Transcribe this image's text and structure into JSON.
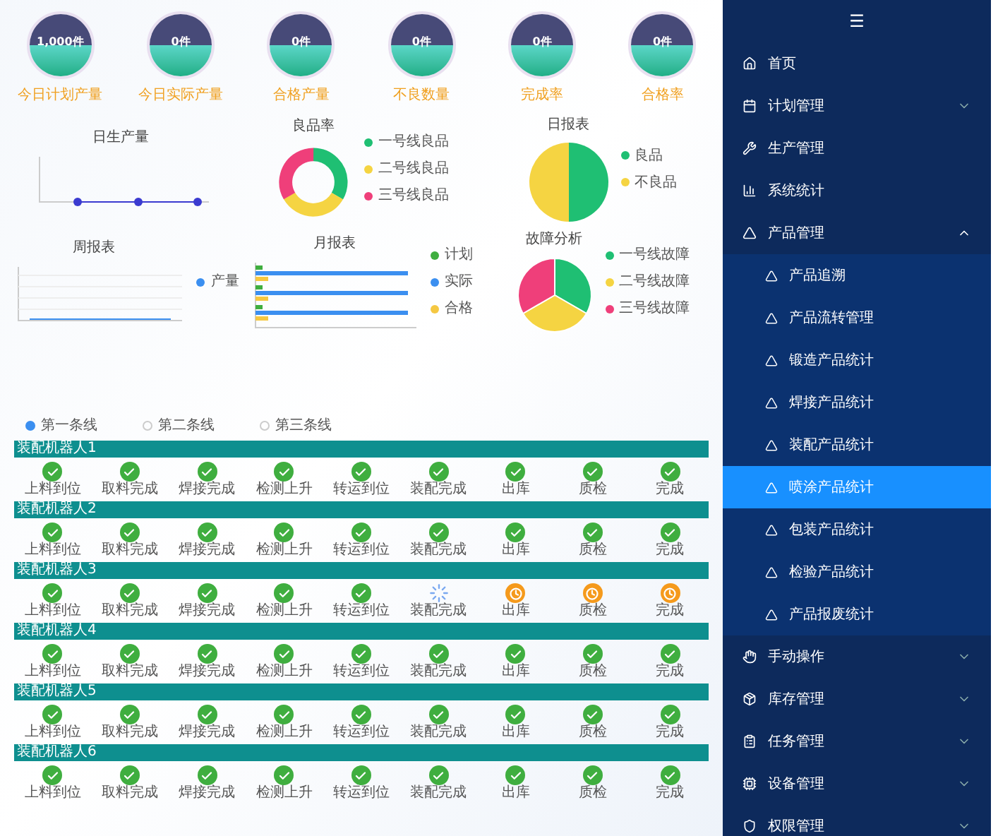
{
  "gauges": [
    {
      "value": "1,000件",
      "label": "今日计划产量"
    },
    {
      "value": "0件",
      "label": "今日实际产量"
    },
    {
      "value": "0件",
      "label": "合格产量"
    },
    {
      "value": "0件",
      "label": "不良数量"
    },
    {
      "value": "0件",
      "label": "完成率"
    },
    {
      "value": "0件",
      "label": "合格率"
    }
  ],
  "charts": [
    {
      "kind": "line",
      "title": "日生产量"
    },
    {
      "kind": "donut",
      "title": "良品率",
      "legend": [
        {
          "label": "一号线良品",
          "color": "#1fbf73"
        },
        {
          "label": "二号线良品",
          "color": "#f5d442"
        },
        {
          "label": "三号线良品",
          "color": "#ef3f7a"
        }
      ]
    },
    {
      "kind": "half",
      "title": "日报表",
      "legend": [
        {
          "label": "良品",
          "color": "#1fbf73"
        },
        {
          "label": "不良品",
          "color": "#f5d442"
        }
      ]
    },
    {
      "kind": "area",
      "title": "周报表",
      "legend": [
        {
          "label": "产量",
          "color": "#3b8ff0"
        }
      ]
    },
    {
      "kind": "bar",
      "title": "月报表",
      "legend": [
        {
          "label": "计划",
          "color": "#3fae3f"
        },
        {
          "label": "实际",
          "color": "#3b8ff0"
        },
        {
          "label": "合格",
          "color": "#f5c842"
        }
      ]
    },
    {
      "kind": "pie",
      "title": "故障分析",
      "legend": [
        {
          "label": "一号线故障",
          "color": "#1fbf73"
        },
        {
          "label": "二号线故障",
          "color": "#f5d442"
        },
        {
          "label": "三号线故障",
          "color": "#ef3f7a"
        }
      ]
    }
  ],
  "line_tabs": [
    {
      "label": "第一条线",
      "selected": true
    },
    {
      "label": "第二条线",
      "selected": false
    },
    {
      "label": "第三条线",
      "selected": false
    }
  ],
  "groups": [
    {
      "title": "装配机器人1",
      "steps": [
        {
          "label": "上料到位",
          "kind": "done"
        },
        {
          "label": "取料完成",
          "kind": "done"
        },
        {
          "label": "焊接完成",
          "kind": "done"
        },
        {
          "label": "检测上升",
          "kind": "done"
        },
        {
          "label": "转运到位",
          "kind": "done"
        },
        {
          "label": "装配完成",
          "kind": "done"
        },
        {
          "label": "出库",
          "kind": "done"
        },
        {
          "label": "质检",
          "kind": "done"
        },
        {
          "label": "完成",
          "kind": "done"
        }
      ]
    },
    {
      "title": "装配机器人2",
      "steps": [
        {
          "label": "上料到位",
          "kind": "done"
        },
        {
          "label": "取料完成",
          "kind": "done"
        },
        {
          "label": "焊接完成",
          "kind": "done"
        },
        {
          "label": "检测上升",
          "kind": "done"
        },
        {
          "label": "转运到位",
          "kind": "done"
        },
        {
          "label": "装配完成",
          "kind": "done"
        },
        {
          "label": "出库",
          "kind": "done"
        },
        {
          "label": "质检",
          "kind": "done"
        },
        {
          "label": "完成",
          "kind": "done"
        }
      ]
    },
    {
      "title": "装配机器人3",
      "steps": [
        {
          "label": "上料到位",
          "kind": "done"
        },
        {
          "label": "取料完成",
          "kind": "done"
        },
        {
          "label": "焊接完成",
          "kind": "done"
        },
        {
          "label": "检测上升",
          "kind": "done"
        },
        {
          "label": "转运到位",
          "kind": "done"
        },
        {
          "label": "装配完成",
          "kind": "running"
        },
        {
          "label": "出库",
          "kind": "waiting"
        },
        {
          "label": "质检",
          "kind": "waiting"
        },
        {
          "label": "完成",
          "kind": "waiting"
        }
      ]
    },
    {
      "title": "装配机器人4",
      "steps": [
        {
          "label": "上料到位",
          "kind": "done"
        },
        {
          "label": "取料完成",
          "kind": "done"
        },
        {
          "label": "焊接完成",
          "kind": "done"
        },
        {
          "label": "检测上升",
          "kind": "done"
        },
        {
          "label": "转运到位",
          "kind": "done"
        },
        {
          "label": "装配完成",
          "kind": "done"
        },
        {
          "label": "出库",
          "kind": "done"
        },
        {
          "label": "质检",
          "kind": "done"
        },
        {
          "label": "完成",
          "kind": "done"
        }
      ]
    },
    {
      "title": "装配机器人5",
      "steps": [
        {
          "label": "上料到位",
          "kind": "done"
        },
        {
          "label": "取料完成",
          "kind": "done"
        },
        {
          "label": "焊接完成",
          "kind": "done"
        },
        {
          "label": "检测上升",
          "kind": "done"
        },
        {
          "label": "转运到位",
          "kind": "done"
        },
        {
          "label": "装配完成",
          "kind": "done"
        },
        {
          "label": "出库",
          "kind": "done"
        },
        {
          "label": "质检",
          "kind": "done"
        },
        {
          "label": "完成",
          "kind": "done"
        }
      ]
    },
    {
      "title": "装配机器人6",
      "steps": [
        {
          "label": "上料到位",
          "kind": "done"
        },
        {
          "label": "取料完成",
          "kind": "done"
        },
        {
          "label": "焊接完成",
          "kind": "done"
        },
        {
          "label": "检测上升",
          "kind": "done"
        },
        {
          "label": "转运到位",
          "kind": "done"
        },
        {
          "label": "装配完成",
          "kind": "done"
        },
        {
          "label": "出库",
          "kind": "done"
        },
        {
          "label": "质检",
          "kind": "done"
        },
        {
          "label": "完成",
          "kind": "done"
        }
      ]
    }
  ],
  "sidebar": {
    "logo": "☰",
    "items": [
      {
        "label": "首页",
        "expandable": false
      },
      {
        "label": "计划管理",
        "expandable": true,
        "expanded": false
      },
      {
        "label": "生产管理",
        "expandable": false
      },
      {
        "label": "系统统计",
        "expandable": false
      },
      {
        "label": "产品管理",
        "expandable": true,
        "expanded": true,
        "children": [
          {
            "label": "产品追溯",
            "selected": false
          },
          {
            "label": "产品流转管理",
            "selected": false
          },
          {
            "label": "锻造产品统计",
            "selected": false
          },
          {
            "label": "焊接产品统计",
            "selected": false
          },
          {
            "label": "装配产品统计",
            "selected": false
          },
          {
            "label": "喷涂产品统计",
            "selected": true
          },
          {
            "label": "包装产品统计",
            "selected": false
          },
          {
            "label": "检验产品统计",
            "selected": false
          },
          {
            "label": "产品报废统计",
            "selected": false
          }
        ]
      },
      {
        "label": "手动操作",
        "expandable": true,
        "expanded": false
      },
      {
        "label": "库存管理",
        "expandable": true,
        "expanded": false
      },
      {
        "label": "任务管理",
        "expandable": true,
        "expanded": false
      },
      {
        "label": "设备管理",
        "expandable": true,
        "expanded": false
      },
      {
        "label": "权限管理",
        "expandable": true,
        "expanded": false
      }
    ]
  }
}
